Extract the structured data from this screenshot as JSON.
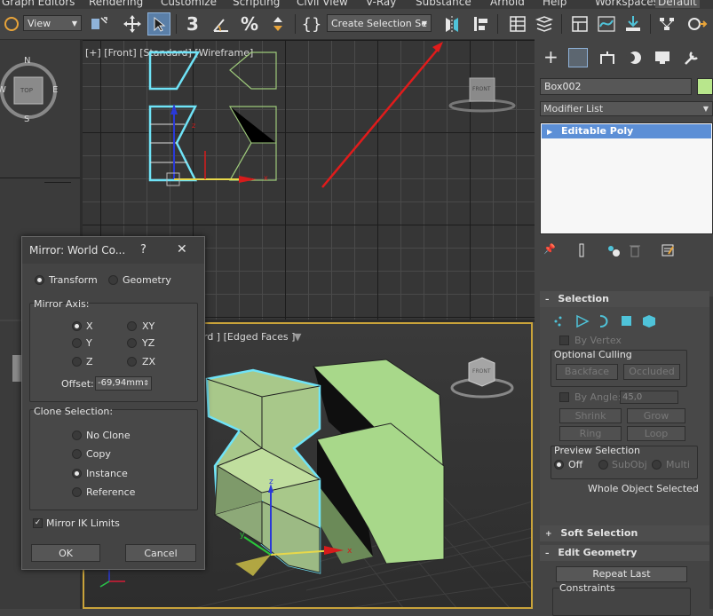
{
  "menubar": [
    "Graph Editors",
    "Rendering",
    "Customize",
    "Scripting",
    "Civil View",
    "V-Ray",
    "Substance",
    "Arnold",
    "Help"
  ],
  "workspaces": {
    "label": "Workspaces:",
    "value": "Default"
  },
  "toolbar": {
    "view_dropdown": "View",
    "selection_set_dropdown": "Create Selection Se",
    "snap_label": "3"
  },
  "viewport_front": {
    "label": "[+] [Front] [Standard] [Wireframe]",
    "cube_label": "FRONT"
  },
  "viewport_top": {
    "compass_n": "N",
    "compass_s": "S",
    "compass_w": "W",
    "compass_e": "E",
    "cube_label": "TOP"
  },
  "viewport_persp": {
    "label": "rd ] [Edged Faces ]",
    "cube_label": "FRONT"
  },
  "panel": {
    "object_name": "Box002",
    "object_color": "#b8e68c",
    "modifier_list": "Modifier List",
    "stack_item": "Editable Poly",
    "selection": {
      "title": "Selection",
      "by_vertex": "By Vertex",
      "optional_culling": "Optional Culling",
      "backface": "Backface",
      "occluded": "Occluded",
      "by_angle": "By Angle:",
      "angle_value": "45,0",
      "shrink": "Shrink",
      "grow": "Grow",
      "ring": "Ring",
      "loop": "Loop",
      "preview_selection": "Preview Selection",
      "preview_options": [
        "Off",
        "SubObj",
        "Multi"
      ],
      "status": "Whole Object Selected"
    },
    "soft_selection": "Soft Selection",
    "edit_geometry": {
      "title": "Edit Geometry",
      "repeat_last": "Repeat Last",
      "constraints": "Constraints"
    }
  },
  "dialog": {
    "title": "Mirror: World Co...",
    "help": "?",
    "close": "✕",
    "mode_options": [
      "Transform",
      "Geometry"
    ],
    "mode_selected": "Transform",
    "mirror_axis": {
      "title": "Mirror Axis:",
      "options": [
        "X",
        "Y",
        "Z",
        "XY",
        "YZ",
        "ZX"
      ],
      "selected": "X",
      "offset_label": "Offset:",
      "offset_value": "-69,94mm"
    },
    "clone_selection": {
      "title": "Clone Selection:",
      "options": [
        "No Clone",
        "Copy",
        "Instance",
        "Reference"
      ],
      "selected": "Instance"
    },
    "mirror_ik": "Mirror IK Limits",
    "mirror_ik_checked": true,
    "ok": "OK",
    "cancel": "Cancel"
  },
  "colors": {
    "selection_cyan": "#6fe3f7",
    "mesh_green": "#9dc97a",
    "arrow_red": "#e11b1b",
    "highlight_blue": "#5c8fd6"
  }
}
